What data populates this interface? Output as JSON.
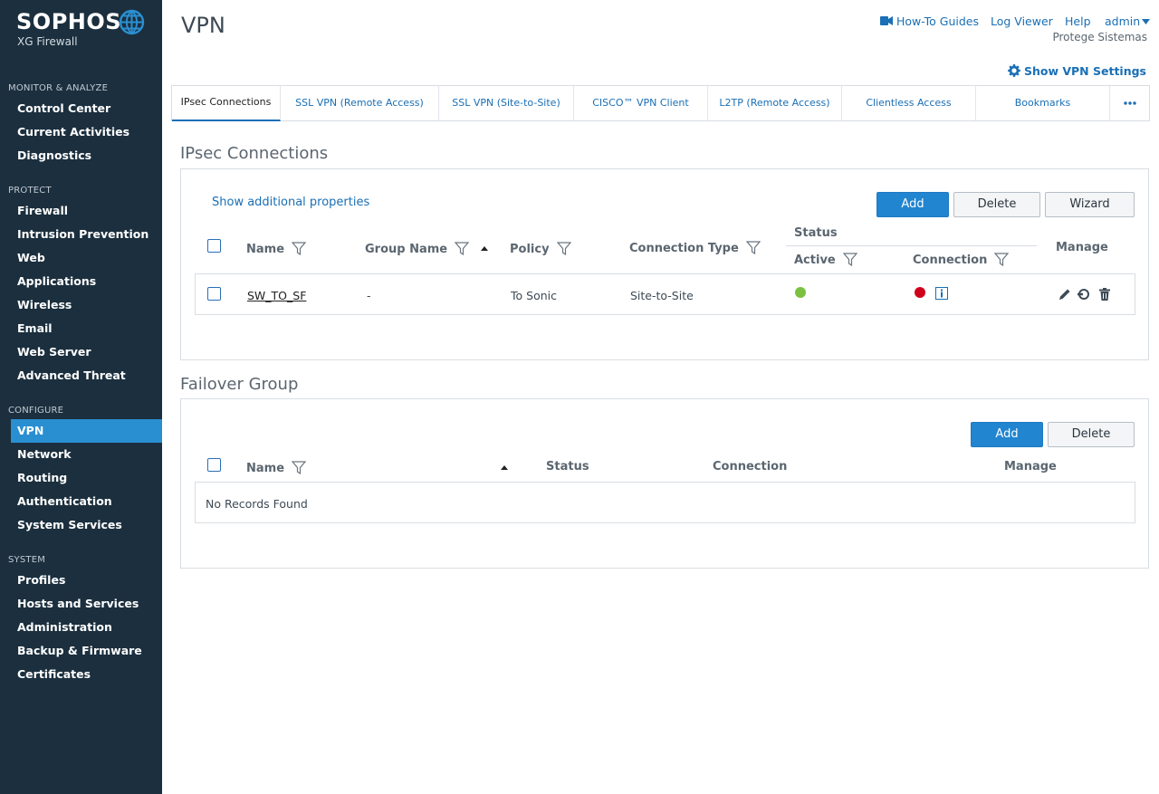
{
  "brand": {
    "name": "SOPHOS",
    "product": "XG Firewall"
  },
  "sidebar": {
    "sections": [
      {
        "title": "MONITOR & ANALYZE",
        "items": [
          "Control Center",
          "Current Activities",
          "Diagnostics"
        ]
      },
      {
        "title": "PROTECT",
        "items": [
          "Firewall",
          "Intrusion Prevention",
          "Web",
          "Applications",
          "Wireless",
          "Email",
          "Web Server",
          "Advanced Threat"
        ]
      },
      {
        "title": "CONFIGURE",
        "items": [
          "VPN",
          "Network",
          "Routing",
          "Authentication",
          "System Services"
        ]
      },
      {
        "title": "SYSTEM",
        "items": [
          "Profiles",
          "Hosts and Services",
          "Administration",
          "Backup & Firmware",
          "Certificates"
        ]
      }
    ],
    "active": "VPN"
  },
  "header": {
    "title": "VPN",
    "links": {
      "howto": "How-To Guides",
      "logviewer": "Log Viewer",
      "help": "Help",
      "user": "admin"
    },
    "company": "Protege Sistemas",
    "settings": "Show VPN Settings"
  },
  "tabs": [
    "IPsec Connections",
    "SSL VPN (Remote Access)",
    "SSL VPN (Site-to-Site)",
    "CISCO™ VPN Client",
    "L2TP (Remote Access)",
    "Clientless Access",
    "Bookmarks"
  ],
  "ipsec": {
    "title": "IPsec Connections",
    "show_props": "Show additional properties",
    "buttons": {
      "add": "Add",
      "delete": "Delete",
      "wizard": "Wizard"
    },
    "columns": {
      "name": "Name",
      "group": "Group Name",
      "policy": "Policy",
      "type": "Connection Type",
      "status": "Status",
      "active": "Active",
      "connection": "Connection",
      "manage": "Manage"
    },
    "rows": [
      {
        "name": "SW_TO_SF",
        "group": "-",
        "policy": "To Sonic",
        "type": "Site-to-Site",
        "active_color": "#7ac142",
        "connection_color": "#d0021b"
      }
    ]
  },
  "failover": {
    "title": "Failover Group",
    "buttons": {
      "add": "Add",
      "delete": "Delete"
    },
    "columns": {
      "name": "Name",
      "status": "Status",
      "connection": "Connection",
      "manage": "Manage"
    },
    "empty": "No Records Found"
  }
}
